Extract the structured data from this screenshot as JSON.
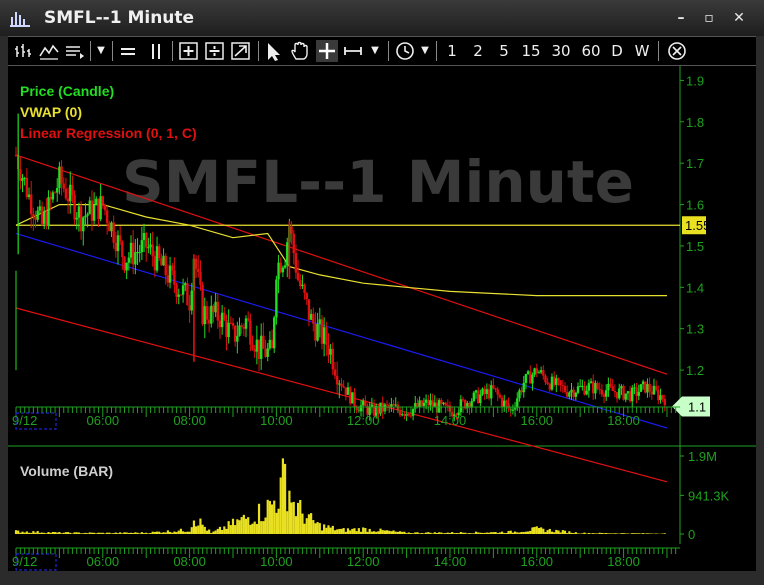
{
  "window": {
    "title": "SMFL--1 Minute",
    "minimize": "–",
    "maximize": "▫",
    "close": "✕"
  },
  "toolbar": {
    "timeframes": [
      "1",
      "2",
      "5",
      "15",
      "30",
      "60",
      "D",
      "W"
    ],
    "icons": [
      "bar-style-icon",
      "study-icon",
      "template-icon",
      "dropdown-icon",
      "horizontal-line-icon",
      "vertical-line-icon",
      "zoom-in-icon",
      "zoom-out-icon",
      "zoom-reset-icon",
      "pointer-icon",
      "pan-hand-icon",
      "crosshair-icon",
      "measure-icon",
      "dropdown-icon",
      "clock-icon",
      "dropdown-icon",
      "close-circle-icon"
    ]
  },
  "colors": {
    "price": "#22dd22",
    "vwap": "#e8e030",
    "regression": "#e01010",
    "regression_center": "#1a1aee",
    "volume": "#e8e020",
    "axis": "#1fa01f"
  },
  "chart_data": [
    {
      "type": "candlestick",
      "watermark": "SMFL--1 Minute",
      "legend": [
        "Price (Candle)",
        "VWAP (0)",
        "Linear Regression (0, 1, C)"
      ],
      "y_ticks": [
        "1.9",
        "1.8",
        "1.7",
        "1.6",
        "1.5",
        "1.4",
        "1.3",
        "1.2",
        "1.1"
      ],
      "x_ticks": [
        "9/12",
        "06:00",
        "08:00",
        "10:00",
        "12:00",
        "14:00",
        "16:00",
        "18:00"
      ],
      "ylim": [
        1.06,
        1.93
      ],
      "price_flags": [
        {
          "label": "1.55",
          "value": 1.55
        },
        {
          "label": "1.1",
          "value": 1.1
        }
      ],
      "price_path": [
        [
          4.0,
          1.72
        ],
        [
          4.3,
          1.62
        ],
        [
          4.6,
          1.55
        ],
        [
          5.0,
          1.66
        ],
        [
          5.5,
          1.57
        ],
        [
          6.0,
          1.6
        ],
        [
          6.5,
          1.47
        ],
        [
          7.0,
          1.5
        ],
        [
          7.5,
          1.43
        ],
        [
          8.0,
          1.37
        ],
        [
          8.1,
          1.48
        ],
        [
          8.3,
          1.34
        ],
        [
          8.7,
          1.33
        ],
        [
          9.0,
          1.28
        ],
        [
          9.3,
          1.32
        ],
        [
          9.6,
          1.25
        ],
        [
          9.9,
          1.24
        ],
        [
          10.0,
          1.45
        ],
        [
          10.2,
          1.48
        ],
        [
          10.3,
          1.55
        ],
        [
          10.5,
          1.42
        ],
        [
          10.8,
          1.32
        ],
        [
          11.2,
          1.26
        ],
        [
          11.5,
          1.17
        ],
        [
          11.8,
          1.12
        ],
        [
          12.2,
          1.1
        ],
        [
          12.6,
          1.11
        ],
        [
          13.0,
          1.1
        ],
        [
          13.5,
          1.12
        ],
        [
          14.0,
          1.1
        ],
        [
          14.5,
          1.13
        ],
        [
          15.0,
          1.15
        ],
        [
          15.4,
          1.1
        ],
        [
          15.7,
          1.17
        ],
        [
          16.0,
          1.2
        ],
        [
          16.3,
          1.17
        ],
        [
          16.7,
          1.15
        ],
        [
          17.2,
          1.16
        ],
        [
          17.7,
          1.15
        ],
        [
          18.2,
          1.14
        ],
        [
          18.5,
          1.16
        ],
        [
          18.8,
          1.14
        ],
        [
          19.0,
          1.13
        ]
      ],
      "vwap_path": [
        [
          4.0,
          1.55
        ],
        [
          5.0,
          1.6
        ],
        [
          6.0,
          1.6
        ],
        [
          7.0,
          1.57
        ],
        [
          8.0,
          1.55
        ],
        [
          9.0,
          1.52
        ],
        [
          9.8,
          1.53
        ],
        [
          10.3,
          1.45
        ],
        [
          11.0,
          1.43
        ],
        [
          12.0,
          1.41
        ],
        [
          13.0,
          1.4
        ],
        [
          14.0,
          1.39
        ],
        [
          15.0,
          1.385
        ],
        [
          16.0,
          1.38
        ],
        [
          19.0,
          1.38
        ]
      ],
      "regression_center": [
        [
          4.0,
          1.53
        ],
        [
          19.0,
          1.06
        ]
      ],
      "regression_upper": [
        [
          4.0,
          1.72
        ],
        [
          19.0,
          1.19
        ]
      ],
      "regression_lower": [
        [
          4.0,
          1.35
        ],
        [
          19.0,
          0.93
        ]
      ],
      "horizontal_line": 1.55
    },
    {
      "type": "bar",
      "title": "Volume (BAR)",
      "y_ticks": [
        "1.9M",
        "941.3K",
        "0"
      ],
      "x_ticks": [
        "9/12",
        "06:00",
        "08:00",
        "10:00",
        "12:00",
        "14:00",
        "16:00",
        "18:00"
      ],
      "ylim": [
        0,
        1900000
      ],
      "volume_profile": [
        [
          4.0,
          80000
        ],
        [
          5.0,
          40000
        ],
        [
          6.0,
          30000
        ],
        [
          7.0,
          40000
        ],
        [
          8.0,
          120000
        ],
        [
          8.1,
          520000
        ],
        [
          8.5,
          30000
        ],
        [
          9.7,
          700000
        ],
        [
          9.9,
          900000
        ],
        [
          10.1,
          1300000
        ],
        [
          10.2,
          1800000
        ],
        [
          10.4,
          900000
        ],
        [
          10.7,
          500000
        ],
        [
          11.0,
          250000
        ],
        [
          11.5,
          120000
        ],
        [
          12.0,
          150000
        ],
        [
          13.0,
          40000
        ],
        [
          14.0,
          40000
        ],
        [
          15.0,
          50000
        ],
        [
          15.5,
          70000
        ],
        [
          16.0,
          150000
        ],
        [
          17.0,
          30000
        ],
        [
          18.0,
          20000
        ],
        [
          19.0,
          15000
        ]
      ]
    }
  ]
}
